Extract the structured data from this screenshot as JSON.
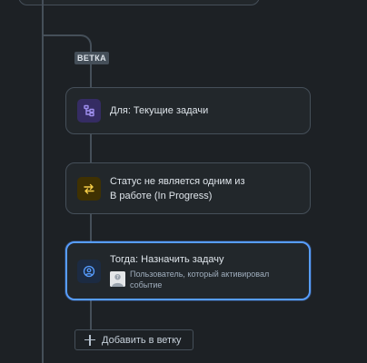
{
  "branch": {
    "tag": "ВЕТКА"
  },
  "cards": [
    {
      "icon": "branch-structure-icon",
      "title": "Для: Текущие задачи",
      "accent": "#9f8fef"
    },
    {
      "icon": "swap-arrows-icon",
      "title_line1": "Статус не является одним из",
      "title_line2": "В работе (In Progress)",
      "accent": "#f5cd47"
    },
    {
      "icon": "user-circle-icon",
      "title": "Тогда: Назначить задачу",
      "subtitle_line1": "Пользователь, который активировал",
      "subtitle_line2": "событие",
      "accent": "#579dff"
    }
  ],
  "add_branch": {
    "label": "Добавить в ветку"
  },
  "colors": {
    "background": "#1d2125",
    "card": "#22272b",
    "border": "#454f59",
    "selected": "#579dff"
  }
}
